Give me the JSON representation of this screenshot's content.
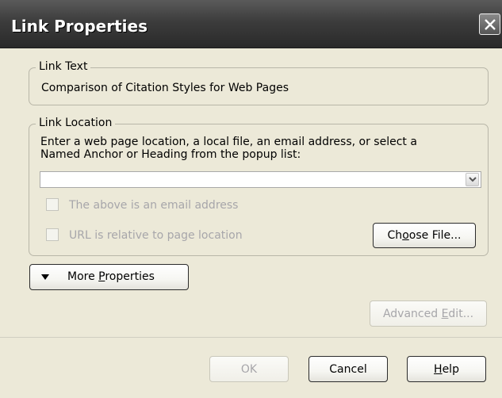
{
  "window": {
    "title": "Link Properties"
  },
  "link_text": {
    "group_label": "Link Text",
    "value": "Comparison of Citation Styles for Web Pages"
  },
  "link_location": {
    "group_label": "Link Location",
    "instruction_line1": "Enter a web page location, a local file, an email address, or select a",
    "instruction_line2": "Named Anchor or Heading from the popup list:",
    "url_value": "",
    "email_checkbox_label": "The above is an email address",
    "relative_checkbox_label": "URL is relative to page location",
    "choose_file_label_pre": "Ch",
    "choose_file_label_accel": "o",
    "choose_file_label_post": "ose File..."
  },
  "more_properties": {
    "label_pre": "More ",
    "label_accel": "P",
    "label_post": "roperties"
  },
  "advanced_edit": {
    "label_pre": "Advanced ",
    "label_accel": "E",
    "label_post": "dit..."
  },
  "footer": {
    "ok_label": "OK",
    "cancel_label": "Cancel",
    "help_label_accel": "H",
    "help_label_post": "elp"
  }
}
